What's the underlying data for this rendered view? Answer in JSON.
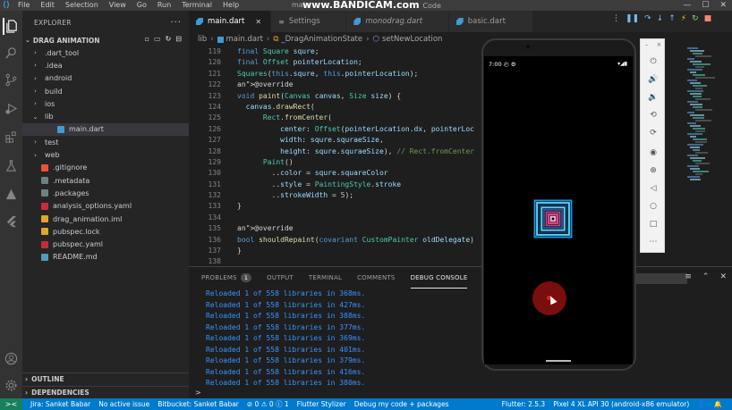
{
  "titlebar": {
    "menu": [
      "File",
      "Edit",
      "Selection",
      "View",
      "Go",
      "Run",
      "Terminal",
      "Help"
    ],
    "title_prefix": "main",
    "watermark": "www.BANDICAM.com",
    "title_suffix": "Code",
    "controls": [
      "—",
      "☐",
      "✕"
    ]
  },
  "sidebar": {
    "header": "EXPLORER",
    "section": "DRAG ANIMATION",
    "items": [
      {
        "label": ".dart_tool",
        "type": "folder"
      },
      {
        "label": ".idea",
        "type": "folder"
      },
      {
        "label": "android",
        "type": "folder"
      },
      {
        "label": "build",
        "type": "folder"
      },
      {
        "label": "ios",
        "type": "folder"
      },
      {
        "label": "lib",
        "type": "folder-open"
      },
      {
        "label": "main.dart",
        "type": "dart",
        "active": true
      },
      {
        "label": "test",
        "type": "folder"
      },
      {
        "label": "web",
        "type": "folder"
      },
      {
        "label": ".gitignore",
        "type": "git"
      },
      {
        "label": ".metadata",
        "type": "file"
      },
      {
        "label": ".packages",
        "type": "file"
      },
      {
        "label": "analysis_options.yaml",
        "type": "yaml"
      },
      {
        "label": "drag_animation.iml",
        "type": "iml"
      },
      {
        "label": "pubspec.lock",
        "type": "lock"
      },
      {
        "label": "pubspec.yaml",
        "type": "yaml"
      },
      {
        "label": "README.md",
        "type": "md"
      }
    ],
    "outline": "OUTLINE",
    "dependencies": "DEPENDENCIES"
  },
  "tabs": [
    {
      "label": "main.dart",
      "active": true,
      "icon": "dart"
    },
    {
      "label": "Settings",
      "active": false,
      "icon": "settings"
    },
    {
      "label": "monodrag.dart",
      "active": false,
      "icon": "dart"
    },
    {
      "label": "basic.dart",
      "active": false,
      "icon": "dart"
    }
  ],
  "breadcrumb": [
    "lib",
    "main.dart",
    "_DragAnimationState",
    "setNewLocation"
  ],
  "editor": {
    "lines": [
      {
        "n": "119",
        "text": "final Square squre;"
      },
      {
        "n": "120",
        "text": "final Offset pointerLocation;"
      },
      {
        "n": "121",
        "text": "Squares(this.squre, this.pointerLocation);"
      },
      {
        "n": "122",
        "text": "@override"
      },
      {
        "n": "123",
        "text": "void paint(Canvas canvas, Size size) {"
      },
      {
        "n": "124",
        "text": "  canvas.drawRect("
      },
      {
        "n": "125",
        "text": "      Rect.fromCenter("
      },
      {
        "n": "126",
        "text": "          center: Offset(pointerLocation.dx, pointerLoc"
      },
      {
        "n": "127",
        "text": "          width: squre.squraeSize,"
      },
      {
        "n": "128",
        "text": "          height: squre.squraeSize), // Rect.fromCenter"
      },
      {
        "n": "129",
        "text": "      Paint()"
      },
      {
        "n": "130",
        "text": "        ..color = squre.squareColor"
      },
      {
        "n": "131",
        "text": "        ..style = PaintingStyle.stroke"
      },
      {
        "n": "132",
        "text": "        ..strokeWidth = 5);"
      },
      {
        "n": "133",
        "text": "}"
      },
      {
        "n": "134",
        "text": ""
      },
      {
        "n": "135",
        "text": "@override"
      },
      {
        "n": "136",
        "text": "bool shouldRepaint(covariant CustomPainter oldDelegate)"
      },
      {
        "n": "137",
        "text": "}"
      },
      {
        "n": "138",
        "text": ""
      }
    ]
  },
  "panel": {
    "tabs": [
      {
        "label": "PROBLEMS",
        "badge": "1",
        "active": false
      },
      {
        "label": "OUTPUT",
        "active": false
      },
      {
        "label": "TERMINAL",
        "active": false
      },
      {
        "label": "COMMENTS",
        "active": false
      },
      {
        "label": "DEBUG CONSOLE",
        "active": true
      }
    ],
    "console": [
      "Reloaded 1 of 558 libraries in 368ms.",
      "Reloaded 1 of 558 libraries in 427ms.",
      "Reloaded 1 of 558 libraries in 388ms.",
      "Reloaded 1 of 558 libraries in 377ms.",
      "Reloaded 1 of 558 libraries in 369ms.",
      "Reloaded 1 of 558 libraries in 401ms.",
      "Reloaded 1 of 558 libraries in 379ms.",
      "Reloaded 1 of 558 libraries in 416ms.",
      "Reloaded 1 of 558 libraries in 380ms."
    ],
    "prompt": ">"
  },
  "statusbar": {
    "remote": "><",
    "items": [
      "Jira: Sanket Babar",
      "No active issue",
      "Bitbucket: Sanket Babar",
      "⊘ 0 ⚠ 0 ⓘ 1",
      "Flutter Stylizer",
      "Debug my code + packages",
      "Flutter: 2.5.3",
      "Pixel 4 XL API 30 (android-x86 emulator)",
      "👤",
      "🔔"
    ]
  },
  "phone": {
    "time": "7:00",
    "status_icons": "▾◢▮"
  },
  "square_colors": [
    "#1e90d8",
    "#5ad0f0",
    "#0d3b6b",
    "#5ad0f0",
    "#2a4fa0",
    "#b04a7a",
    "#e04a9a",
    "#ffb0c8"
  ],
  "circle_color": "#7a0d0d"
}
